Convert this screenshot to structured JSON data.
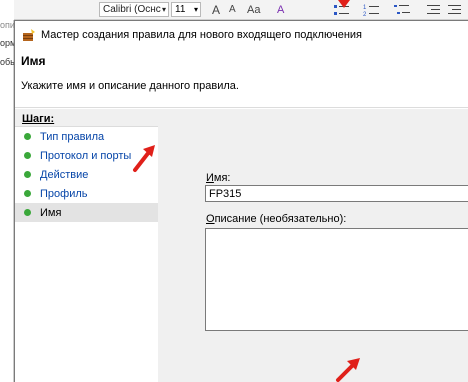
{
  "ribbon": {
    "font_name": "Calibri (Оснс",
    "font_size": "11",
    "grow_font": "A",
    "shrink_font": "A",
    "change_case": "Aa",
    "clear_format": "A"
  },
  "background_fragments": [
    "опис",
    "орм",
    "обь"
  ],
  "window": {
    "title": "Мастер создания правила для нового входящего подключения"
  },
  "header": {
    "title": "Имя",
    "description": "Укажите имя и описание данного правила."
  },
  "steps": {
    "label": "Шаги:",
    "items": [
      {
        "label": "Тип правила",
        "active": false
      },
      {
        "label": "Протокол и порты",
        "active": false
      },
      {
        "label": "Действие",
        "active": false
      },
      {
        "label": "Профиль",
        "active": false
      },
      {
        "label": "Имя",
        "active": true
      }
    ]
  },
  "form": {
    "name_label_accel": "И",
    "name_label_rest": "мя:",
    "name_value": "FP315",
    "desc_label_accel": "О",
    "desc_label_rest": "писание (необязательно):",
    "desc_value": ""
  },
  "colors": {
    "step_dot": "#3aa83a",
    "link": "#0645a8",
    "arrow": "#e0201a"
  }
}
